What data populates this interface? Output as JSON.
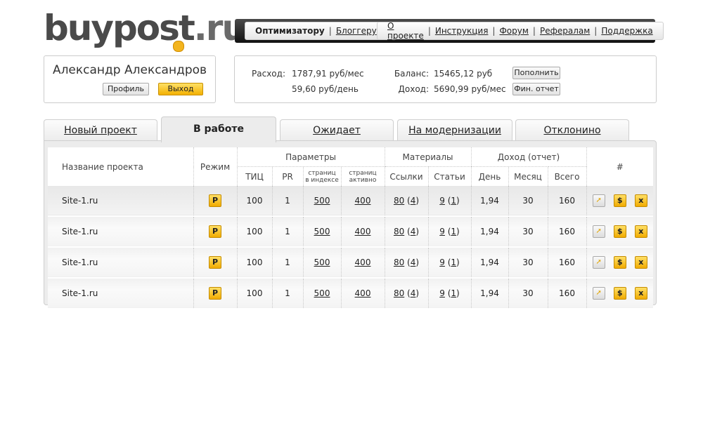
{
  "logo": {
    "text_main": "buypost",
    "text_dot": ".",
    "text_ru": "ru"
  },
  "topnav": {
    "left": [
      {
        "label": "Оптимизатору",
        "active": true
      },
      {
        "label": "Блоггеру",
        "active": false
      }
    ],
    "right": [
      {
        "label": "О проекте"
      },
      {
        "label": "Инструкция"
      },
      {
        "label": "Форум"
      },
      {
        "label": "Рефералам"
      },
      {
        "label": "Поддержка"
      }
    ],
    "separator": "|"
  },
  "user": {
    "name": "Александр Александров",
    "profile_label": "Профиль",
    "logout_label": "Выход"
  },
  "finance": {
    "expense_label": "Расход:",
    "expense_month": "1787,91 руб/мес",
    "expense_day": "59,60 руб/день",
    "balance_label": "Баланс:",
    "balance_value": "15465,12 руб",
    "income_label": "Доход:",
    "income_value": "5690,99 руб/мес",
    "topup_label": "Пополнить",
    "report_label": "Фин. отчет"
  },
  "tabs": [
    {
      "label": "Новый проект",
      "active": false
    },
    {
      "label": "В работе",
      "active": true
    },
    {
      "label": "Ожидает",
      "active": false
    },
    {
      "label": "На модернизации",
      "active": false
    },
    {
      "label": "Отклонино",
      "active": false
    }
  ],
  "table": {
    "headers": {
      "project_name": "Название проекта",
      "mode": "Режим",
      "params_group": "Параметры",
      "tic": "ТИЦ",
      "pr": "PR",
      "pages_indexed_1": "страниц",
      "pages_indexed_2": "в индексе",
      "pages_active_1": "страниц",
      "pages_active_2": "активно",
      "materials_group": "Материалы",
      "links": "Ссылки",
      "articles": "Статьи",
      "income_group": "Доход (отчет)",
      "day": "День",
      "month": "Месяц",
      "total": "Всего",
      "actions": "#"
    },
    "rows": [
      {
        "name": "Site-1.ru",
        "mode": "P",
        "tic": "100",
        "pr": "1",
        "pages_indexed": "500",
        "pages_active": "400",
        "links": "80",
        "links_new": "4",
        "articles": "9",
        "articles_new": "1",
        "day": "1,94",
        "month": "30",
        "total": "160"
      },
      {
        "name": "Site-1.ru",
        "mode": "P",
        "tic": "100",
        "pr": "1",
        "pages_indexed": "500",
        "pages_active": "400",
        "links": "80",
        "links_new": "4",
        "articles": "9",
        "articles_new": "1",
        "day": "1,94",
        "month": "30",
        "total": "160"
      },
      {
        "name": "Site-1.ru",
        "mode": "P",
        "tic": "100",
        "pr": "1",
        "pages_indexed": "500",
        "pages_active": "400",
        "links": "80",
        "links_new": "4",
        "articles": "9",
        "articles_new": "1",
        "day": "1,94",
        "month": "30",
        "total": "160"
      },
      {
        "name": "Site-1.ru",
        "mode": "P",
        "tic": "100",
        "pr": "1",
        "pages_indexed": "500",
        "pages_active": "400",
        "links": "80",
        "links_new": "4",
        "articles": "9",
        "articles_new": "1",
        "day": "1,94",
        "month": "30",
        "total": "160"
      }
    ],
    "row_actions": {
      "edit_icon": "cursor-icon",
      "pay_icon": "dollar-icon",
      "delete_icon": "close-icon",
      "pay_glyph": "$",
      "delete_glyph": "x",
      "edit_glyph": "➚"
    }
  },
  "colors": {
    "accent_yellow": "#f3b41e",
    "nav_dark": "#222222"
  }
}
